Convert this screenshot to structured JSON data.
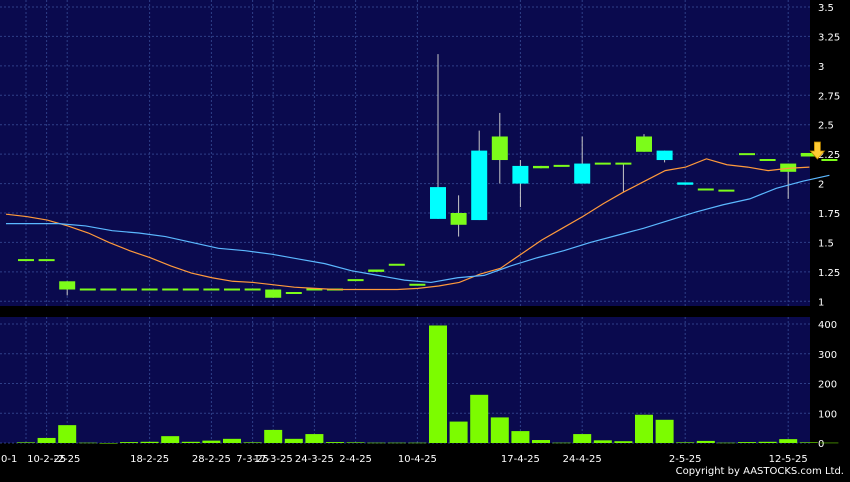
{
  "copyright": "Copyright by AASTOCKS.com Ltd.",
  "colors": {
    "background": "#000000",
    "panel": "#0a0a4e",
    "grid": "#2e3f88",
    "up_candle": "#7cfc1a",
    "down_candle": "#00ffff",
    "ma_short": "#ff9a3c",
    "ma_long": "#5bb8ff",
    "volume": "#7cfc00",
    "marker": "#ffcc33"
  },
  "chart_data": [
    {
      "type": "candlestick",
      "title": "",
      "ylim": [
        0.96,
        3.5
      ],
      "yticks": [
        1,
        1.25,
        1.5,
        1.75,
        2,
        2.25,
        2.5,
        2.75,
        3,
        3.25,
        3.5
      ],
      "grid": true,
      "candles": [
        {
          "o": 1.35,
          "h": 1.35,
          "l": 1.35,
          "c": 1.35
        },
        {
          "o": 1.35,
          "h": 1.35,
          "l": 1.35,
          "c": 1.35
        },
        {
          "o": 1.1,
          "h": 1.17,
          "l": 1.05,
          "c": 1.17
        },
        {
          "o": 1.1,
          "h": 1.1,
          "l": 1.1,
          "c": 1.1
        },
        {
          "o": 1.1,
          "h": 1.1,
          "l": 1.1,
          "c": 1.1
        },
        {
          "o": 1.1,
          "h": 1.1,
          "l": 1.1,
          "c": 1.1
        },
        {
          "o": 1.1,
          "h": 1.1,
          "l": 1.1,
          "c": 1.1
        },
        {
          "o": 1.1,
          "h": 1.1,
          "l": 1.1,
          "c": 1.1
        },
        {
          "o": 1.1,
          "h": 1.1,
          "l": 1.1,
          "c": 1.1
        },
        {
          "o": 1.1,
          "h": 1.1,
          "l": 1.1,
          "c": 1.1
        },
        {
          "o": 1.1,
          "h": 1.1,
          "l": 1.1,
          "c": 1.1
        },
        {
          "o": 1.1,
          "h": 1.1,
          "l": 1.1,
          "c": 1.1
        },
        {
          "o": 1.03,
          "h": 1.1,
          "l": 1.03,
          "c": 1.1
        },
        {
          "o": 1.07,
          "h": 1.07,
          "l": 1.07,
          "c": 1.07
        },
        {
          "o": 1.1,
          "h": 1.1,
          "l": 1.1,
          "c": 1.1
        },
        {
          "o": 1.1,
          "h": 1.1,
          "l": 1.1,
          "c": 1.1
        },
        {
          "o": 1.18,
          "h": 1.18,
          "l": 1.18,
          "c": 1.18
        },
        {
          "o": 1.25,
          "h": 1.27,
          "l": 1.25,
          "c": 1.27
        },
        {
          "o": 1.31,
          "h": 1.31,
          "l": 1.31,
          "c": 1.31
        },
        {
          "o": 1.14,
          "h": 1.14,
          "l": 1.14,
          "c": 1.14
        },
        {
          "o": 1.97,
          "h": 3.1,
          "l": 1.7,
          "c": 1.7
        },
        {
          "o": 1.65,
          "h": 1.9,
          "l": 1.55,
          "c": 1.75
        },
        {
          "o": 2.28,
          "h": 2.45,
          "l": 1.69,
          "c": 1.69
        },
        {
          "o": 2.2,
          "h": 2.6,
          "l": 2.0,
          "c": 2.4
        },
        {
          "o": 2.15,
          "h": 2.2,
          "l": 1.8,
          "c": 2.0
        },
        {
          "o": 2.13,
          "h": 2.15,
          "l": 2.13,
          "c": 2.15
        },
        {
          "o": 2.15,
          "h": 2.15,
          "l": 2.15,
          "c": 2.15
        },
        {
          "o": 2.17,
          "h": 2.4,
          "l": 2.0,
          "c": 2.0
        },
        {
          "o": 2.17,
          "h": 2.17,
          "l": 2.17,
          "c": 2.17
        },
        {
          "o": 2.17,
          "h": 2.17,
          "l": 1.93,
          "c": 2.17
        },
        {
          "o": 2.27,
          "h": 2.42,
          "l": 2.27,
          "c": 2.4
        },
        {
          "o": 2.28,
          "h": 2.28,
          "l": 2.18,
          "c": 2.2
        },
        {
          "o": 2.01,
          "h": 2.01,
          "l": 1.99,
          "c": 1.99
        },
        {
          "o": 1.95,
          "h": 1.95,
          "l": 1.95,
          "c": 1.95
        },
        {
          "o": 1.94,
          "h": 1.94,
          "l": 1.94,
          "c": 1.94
        },
        {
          "o": 2.25,
          "h": 2.25,
          "l": 2.25,
          "c": 2.25
        },
        {
          "o": 2.2,
          "h": 2.2,
          "l": 2.2,
          "c": 2.2
        },
        {
          "o": 2.1,
          "h": 2.17,
          "l": 1.87,
          "c": 2.17
        },
        {
          "o": 2.23,
          "h": 2.26,
          "l": 2.23,
          "c": 2.26
        },
        {
          "o": 2.2,
          "h": 2.2,
          "l": 2.2,
          "c": 2.2
        }
      ],
      "ma_short": [
        1.74,
        1.72,
        1.69,
        1.64,
        1.58,
        1.5,
        1.43,
        1.37,
        1.3,
        1.24,
        1.2,
        1.17,
        1.16,
        1.14,
        1.12,
        1.11,
        1.1,
        1.1,
        1.1,
        1.1,
        1.11,
        1.13,
        1.16,
        1.23,
        1.28,
        1.4,
        1.52,
        1.62,
        1.72,
        1.83,
        1.93,
        2.02,
        2.11,
        2.14,
        2.21,
        2.16,
        2.14,
        2.11,
        2.13,
        2.14
      ],
      "ma_long": [
        1.66,
        1.66,
        1.66,
        1.64,
        1.6,
        1.58,
        1.55,
        1.5,
        1.45,
        1.43,
        1.4,
        1.36,
        1.32,
        1.26,
        1.22,
        1.18,
        1.16,
        1.2,
        1.22,
        1.3,
        1.37,
        1.43,
        1.5,
        1.56,
        1.62,
        1.69,
        1.76,
        1.82,
        1.87,
        1.96,
        2.02,
        2.07
      ],
      "marker": {
        "index": 39,
        "direction": "down"
      }
    },
    {
      "type": "bar",
      "ylim": [
        0,
        400
      ],
      "yticks": [
        0,
        100,
        200,
        300,
        400
      ],
      "grid": true,
      "values": [
        2,
        17,
        60,
        1,
        0,
        3,
        4,
        23,
        4,
        8,
        14,
        2,
        44,
        14,
        30,
        3,
        2,
        1,
        1,
        1,
        395,
        72,
        162,
        86,
        40,
        10,
        1,
        30,
        9,
        6,
        95,
        78,
        2,
        7,
        1,
        3,
        4,
        13,
        2,
        1
      ]
    }
  ],
  "xaxis": {
    "labels": [
      {
        "i": 0,
        "text": "0-1"
      },
      {
        "i": 1,
        "text": "10-2-25"
      },
      {
        "i": 2,
        "text": "-2-25"
      },
      {
        "i": 6,
        "text": "18-2-25"
      },
      {
        "i": 9,
        "text": "28-2-25"
      },
      {
        "i": 11,
        "text": "7-3-25"
      },
      {
        "i": 12,
        "text": "17-3-25"
      },
      {
        "i": 14,
        "text": "24-3-25"
      },
      {
        "i": 16,
        "text": "2-4-25"
      },
      {
        "i": 19,
        "text": "10-4-25"
      },
      {
        "i": 24,
        "text": "17-4-25"
      },
      {
        "i": 27,
        "text": "24-4-25"
      },
      {
        "i": 32,
        "text": "2-5-25"
      },
      {
        "i": 37,
        "text": "12-5-25"
      }
    ]
  }
}
